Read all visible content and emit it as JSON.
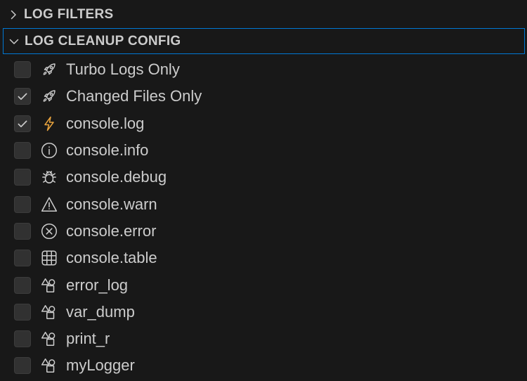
{
  "sections": {
    "filters": {
      "title": "LOG FILTERS",
      "expanded": false
    },
    "cleanup": {
      "title": "LOG CLEANUP CONFIG",
      "expanded": true
    }
  },
  "colors": {
    "accent_border": "#0078d4",
    "lightning": "#e8a33d"
  },
  "items": [
    {
      "label": "Turbo Logs Only",
      "checked": false,
      "icon": "rocket-icon"
    },
    {
      "label": "Changed Files Only",
      "checked": true,
      "icon": "rocket-icon"
    },
    {
      "label": "console.log",
      "checked": true,
      "icon": "lightning-icon"
    },
    {
      "label": "console.info",
      "checked": false,
      "icon": "info-icon"
    },
    {
      "label": "console.debug",
      "checked": false,
      "icon": "bug-icon"
    },
    {
      "label": "console.warn",
      "checked": false,
      "icon": "warning-icon"
    },
    {
      "label": "console.error",
      "checked": false,
      "icon": "error-icon"
    },
    {
      "label": "console.table",
      "checked": false,
      "icon": "table-icon"
    },
    {
      "label": "error_log",
      "checked": false,
      "icon": "shapes-icon"
    },
    {
      "label": "var_dump",
      "checked": false,
      "icon": "shapes-icon"
    },
    {
      "label": "print_r",
      "checked": false,
      "icon": "shapes-icon"
    },
    {
      "label": "myLogger",
      "checked": false,
      "icon": "shapes-icon"
    }
  ]
}
